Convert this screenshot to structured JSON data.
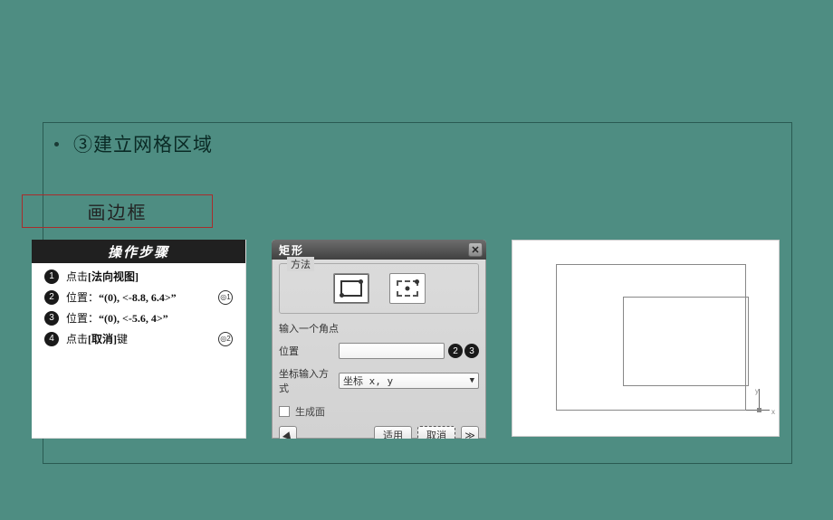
{
  "bullet": {
    "text": "③建立网格区域"
  },
  "subtitle": "画边框",
  "steps": {
    "header": "操作步骤",
    "items": [
      {
        "n": "1",
        "prefix": "点击",
        "bold": "[法向视图]",
        "suffix": ""
      },
      {
        "n": "2",
        "prefix": "位置：",
        "bold": "“(0), <-8.8, 6.4>”",
        "suffix": "",
        "ring": "◎1"
      },
      {
        "n": "3",
        "prefix": "位置：",
        "bold": "“(0), <-5.6, 4>”",
        "suffix": ""
      },
      {
        "n": "4",
        "prefix": "点击",
        "bold": "[取消]",
        "suffix": "键",
        "ring": "◎2"
      }
    ]
  },
  "dialog": {
    "title": "矩形",
    "close": "✕",
    "method_legend": "方法",
    "corner_hint": "输入一个角点",
    "pos_label": "位置",
    "pos_badges": [
      "2",
      "3"
    ],
    "coord_label": "坐标输入方式",
    "coord_value": "坐标 x, y",
    "gen_face": "生成面",
    "apply": "适用",
    "cancel": "取消",
    "next": "≫"
  },
  "axes": {
    "x": "x",
    "y": "y"
  }
}
